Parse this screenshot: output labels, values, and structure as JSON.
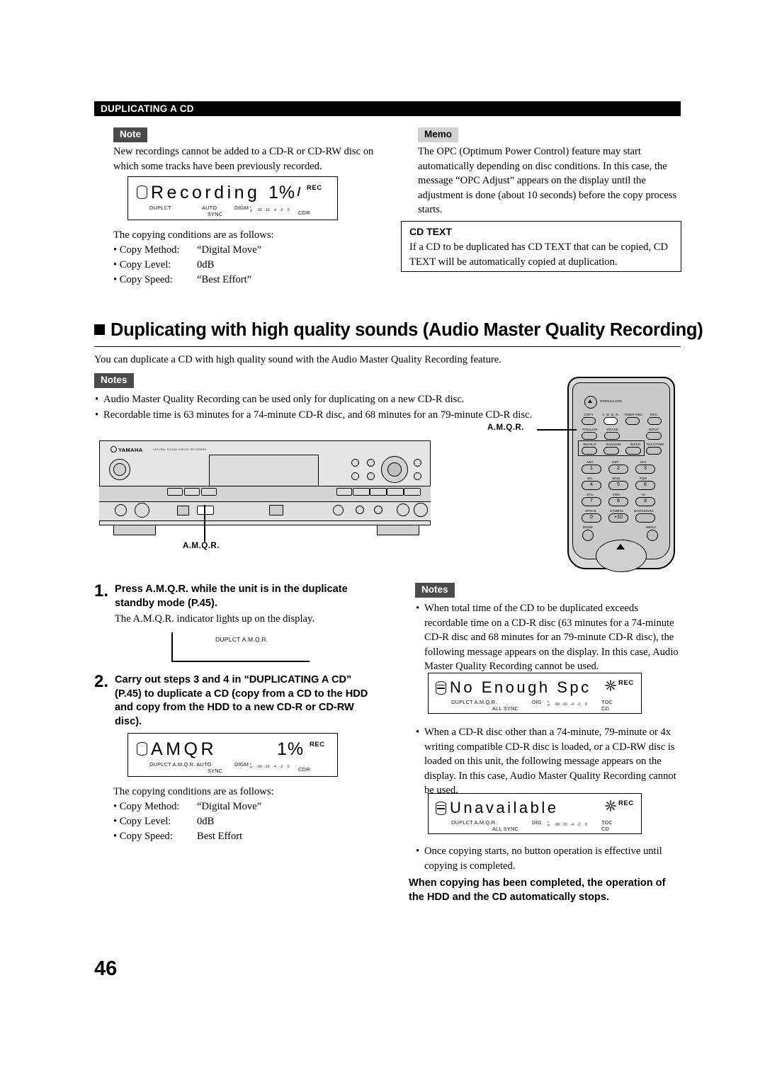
{
  "document": {
    "section_header": "DUPLICATING A CD",
    "page_number": "46"
  },
  "left_column": {
    "note_tag": "Note",
    "note_text": "New recordings cannot be added to a CD-R or CD-RW disc on which some tracks have been previously recorded.",
    "display_recording": {
      "message": "Recording",
      "percent": "1%",
      "rec_label": "REC",
      "indicator_duplct": "DUPLCT",
      "indicator_auto": "AUTO",
      "indicator_sync": "SYNC",
      "indicator_digm": "DIGM",
      "indicator_l": "L",
      "indicator_r": "R",
      "scale": "-30  -10   -4   -2    0",
      "indicator_cdr": "CDR"
    },
    "conditions_intro": "The copying conditions are as follows:",
    "conditions": [
      {
        "label": "• Copy Method:",
        "value": "“Digital Move”"
      },
      {
        "label": "• Copy Level:",
        "value": "0dB"
      },
      {
        "label": "• Copy Speed:",
        "value": "“Best Effort”"
      }
    ]
  },
  "right_column_top": {
    "memo_tag": "Memo",
    "memo_text": "The OPC (Optimum Power Control) feature may start automatically depending on disc conditions. In this case, the message “OPC Adjust” appears on the display until the adjustment is done (about 10 seconds) before the copy process starts.",
    "cdtext_title": "CD TEXT",
    "cdtext_body": "If a CD to be duplicated has CD TEXT that can be copied, CD TEXT will be automatically copied at duplication."
  },
  "heading": {
    "title": "Duplicating with high quality sounds (Audio Master Quality Recording)",
    "intro": "You can duplicate a CD with high quality sound with the Audio Master Quality Recording feature.",
    "notes_tag": "Notes",
    "notes": [
      "Audio Master Quality Recording can be used only for duplicating on a new CD-R disc.",
      "Recordable time is 63 minutes for a 74-minute CD-R disc, and 68 minutes for an 79-minute CD-R disc."
    ]
  },
  "illustrations": {
    "unit_brand": "YAMAHA",
    "unit_model": "NATURAL SOUND HDD/CD RECORDER",
    "unit_callout": "A.M.Q.R.",
    "remote_callout": "A.M.Q.R.",
    "remote": {
      "open_close": "OPEN/CLOSE",
      "row1": [
        "COPY",
        "A. M. Q. R.",
        "TIMER REC",
        "REC"
      ],
      "row2": [
        "FINALIZE",
        "ERASE",
        "INPUT"
      ],
      "row3": [
        "REPEAT",
        "RANDOM",
        "INTRO",
        "TEXT/TIME"
      ],
      "keypad": [
        {
          "letters": "ABC",
          "digit": "1"
        },
        {
          "letters": "DEF",
          "digit": "2"
        },
        {
          "letters": "GHI",
          "digit": "3"
        },
        {
          "letters": "JKL",
          "digit": "4"
        },
        {
          "letters": "MNO",
          "digit": "5"
        },
        {
          "letters": "PQR",
          "digit": "6"
        },
        {
          "letters": "STU",
          "digit": "7"
        },
        {
          "letters": "VWX",
          "digit": "8"
        },
        {
          "letters": "YZ",
          "digit": "9"
        },
        {
          "letters": "SPACE",
          "digit": "0"
        },
        {
          "letters": "SYMBOL",
          "digit": "+10"
        },
        {
          "letters": "BOOKMARK",
          "digit": ""
        }
      ],
      "mode": "MODE",
      "menu": "MENU"
    }
  },
  "steps": [
    {
      "num": "1.",
      "text": "Press A.M.Q.R. while the unit is in the duplicate standby mode (P.45).",
      "sub": "The A.M.Q.R. indicator lights up on the display.",
      "display_text": "DUPLCT A.M.Q.R."
    },
    {
      "num": "2.",
      "text": "Carry out steps 3 and 4 in “DUPLICATING A CD” (P.45) to duplicate a CD (copy from a CD to the HDD and copy from the HDD to a new CD-R or CD-RW disc).",
      "display_amqr": {
        "message": "AMQR",
        "percent": "1%",
        "rec_label": "REC",
        "indicators": "DUPLCT A.M.Q.R. AUTO",
        "indicator_sync": "SYNC",
        "indicator_digm": "DIGM",
        "indicator_l": "L",
        "indicator_r": "R",
        "scale": "-30  -10   -4   -2    0",
        "indicator_cdr": "CDR"
      },
      "conditions_intro": "The copying conditions are as follows:",
      "conditions": [
        {
          "label": "• Copy Method:",
          "value": "“Digital Move”"
        },
        {
          "label": "• Copy Level:",
          "value": "0dB"
        },
        {
          "label": "• Copy Speed:",
          "value": "Best Effort"
        }
      ]
    }
  ],
  "right_column_bottom": {
    "notes_tag": "Notes",
    "note_1": "When total time of the CD to be duplicated exceeds recordable time on a CD-R disc (63 minutes for a 74-minute CD-R disc and 68 minutes for an 79-minute CD-R disc), the following message appears on the display. In this case, Audio Master Quality Recording cannot be used.",
    "display_no_enough": {
      "message": "No Enough Spc",
      "rec_label": "REC",
      "indicators": "DUPLCT A.M.Q.R.",
      "indicator_allsync": "ALL SYNC",
      "indicator_dig": "DIG",
      "indicator_l": "L",
      "indicator_r": "R",
      "scale": "-30  -10   -4   -2    0",
      "indicator_toc": "TOC",
      "indicator_cd": "CD"
    },
    "note_2": "When a CD-R disc other than a 74-minute, 79-minute or 4x writing compatible CD-R disc is loaded, or a CD-RW disc is loaded on this unit, the following message appears on the display. In this case, Audio Master Quality Recording cannot be used.",
    "display_unavailable": {
      "message": "Unavailable",
      "rec_label": "REC",
      "indicators": "DUPLCT A.M.Q.R.",
      "indicator_allsync": "ALL SYNC",
      "indicator_dig": "DIG",
      "indicator_l": "L",
      "indicator_r": "R",
      "scale": "-30  -10   -4   -2    0",
      "indicator_toc": "TOC",
      "indicator_cd": "CD"
    },
    "note_3": "Once copying starts, no button operation is effective until copying is completed.",
    "closing_bold": "When copying has been completed, the operation of the HDD and the CD automatically stops."
  }
}
